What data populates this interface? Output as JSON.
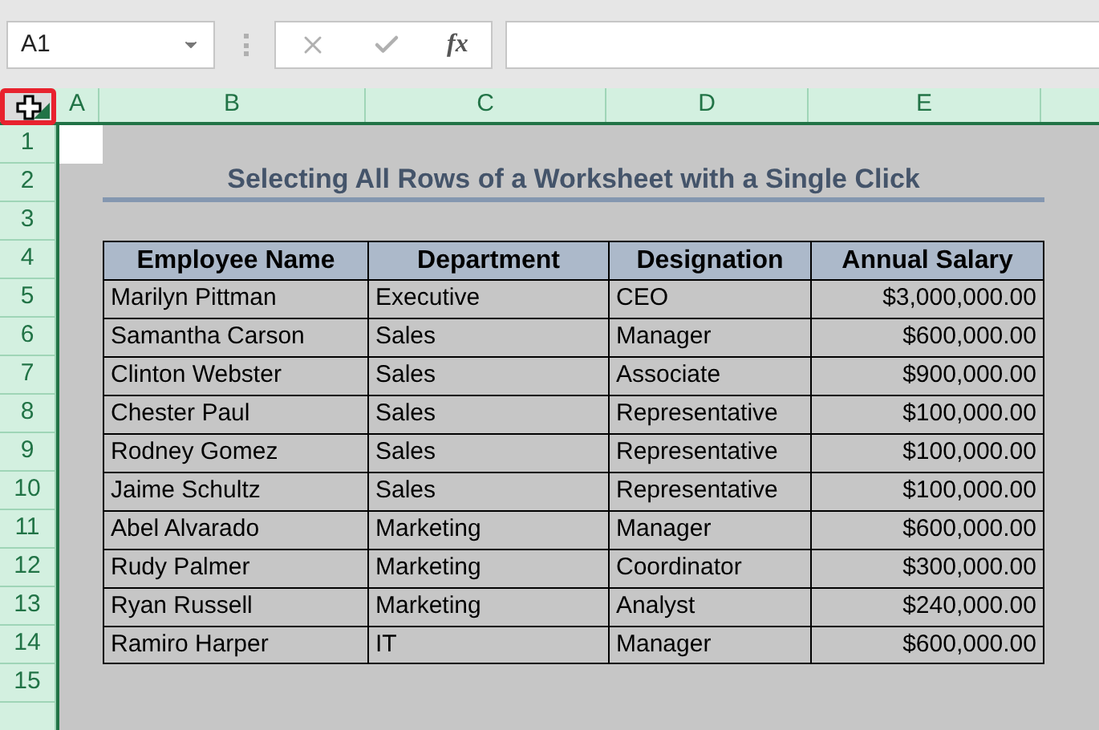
{
  "name_box": {
    "value": "A1"
  },
  "formula_bar": {
    "function_label": "fx"
  },
  "select_all": {
    "selected": true
  },
  "columns": [
    "A",
    "B",
    "C",
    "D",
    "E"
  ],
  "row_numbers": [
    "1",
    "2",
    "3",
    "4",
    "5",
    "6",
    "7",
    "8",
    "9",
    "10",
    "11",
    "12",
    "13",
    "14",
    "15"
  ],
  "sheet": {
    "all_selected": true,
    "title": "Selecting All Rows of a Worksheet with a Single Click"
  },
  "table": {
    "columns": [
      "Employee Name",
      "Department",
      "Designation",
      "Annual Salary"
    ],
    "rows": [
      [
        "Marilyn Pittman",
        "Executive",
        "CEO",
        "$3,000,000.00"
      ],
      [
        "Samantha Carson",
        "Sales",
        "Manager",
        "$600,000.00"
      ],
      [
        "Clinton Webster",
        "Sales",
        "Associate",
        "$900,000.00"
      ],
      [
        "Chester Paul",
        "Sales",
        "Representative",
        "$100,000.00"
      ],
      [
        "Rodney Gomez",
        "Sales",
        "Representative",
        "$100,000.00"
      ],
      [
        "Jaime Schultz",
        "Sales",
        "Representative",
        "$100,000.00"
      ],
      [
        "Abel Alvarado",
        "Marketing",
        "Manager",
        "$600,000.00"
      ],
      [
        "Rudy Palmer",
        "Marketing",
        "Coordinator",
        "$300,000.00"
      ],
      [
        "Ryan Russell",
        "Marketing",
        "Analyst",
        "$240,000.00"
      ],
      [
        "Ramiro Harper",
        "IT",
        "Manager",
        "$600,000.00"
      ]
    ]
  }
}
